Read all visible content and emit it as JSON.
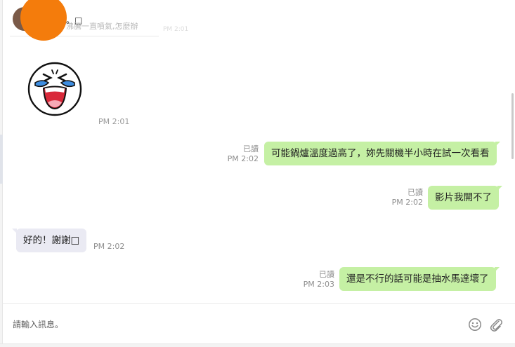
{
  "quote": {
    "name_tail": "。□",
    "text": "沸騰一直噴氣,怎麼辦",
    "time": "PM 2:01"
  },
  "sticker": {
    "time": "PM 2:01",
    "icon": "crying-laughing-sticker"
  },
  "messages": [
    {
      "dir": "out",
      "read": "已讀",
      "time": "PM 2:02",
      "text": "可能鍋爐溫度過高了，妳先關機半小時在試一次看看"
    },
    {
      "dir": "out",
      "read": "已讀",
      "time": "PM 2:02",
      "text": "影片我開不了"
    },
    {
      "dir": "in",
      "time": "PM 2:02",
      "text": "好的！謝謝□"
    },
    {
      "dir": "out",
      "read": "已讀",
      "time": "PM 2:03",
      "text": "還是不行的話可能是抽水馬達壞了"
    }
  ],
  "composer": {
    "placeholder": "請輸入訊息。",
    "emoji_icon": "smiley-icon",
    "attach_icon": "paperclip-icon"
  },
  "colors": {
    "outgoing_bubble": "#c5f0a4",
    "incoming_bubble": "#eaeaf3",
    "overlay": "#f47c0c"
  }
}
